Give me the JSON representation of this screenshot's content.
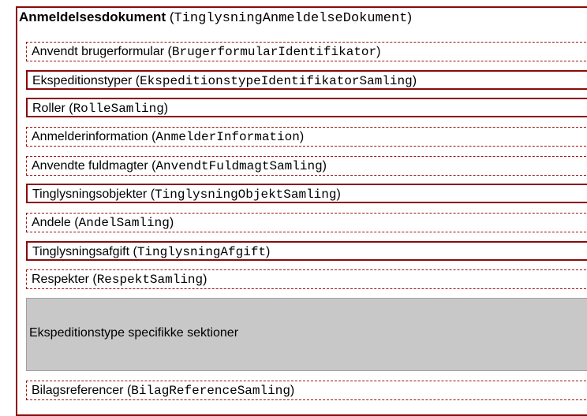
{
  "title": {
    "name": "Anmeldelsesdokument",
    "code": "TinglysningAnmeldelseDokument"
  },
  "rows": [
    {
      "name": "Anvendt brugerformular",
      "code": "BrugerformularIdentifikator",
      "style": "dashed"
    },
    {
      "name": "Ekspeditionstyper",
      "code": "EkspeditionstypeIdentifikatorSamling",
      "style": "solid"
    },
    {
      "name": "Roller",
      "code": "RolleSamling",
      "style": "solid"
    },
    {
      "name": "Anmelderinformation",
      "code": "AnmelderInformation",
      "style": "dashed"
    },
    {
      "name": "Anvendte fuldmagter",
      "code": "AnvendtFuldmagtSamling",
      "style": "dashed"
    },
    {
      "name": "Tinglysningsobjekter",
      "code": "TinglysningObjektSamling",
      "style": "solid"
    },
    {
      "name": "Andele",
      "code": "AndelSamling",
      "style": "dashed"
    },
    {
      "name": "Tinglysningsafgift",
      "code": "TinglysningAfgift",
      "style": "solid"
    },
    {
      "name": "Respekter",
      "code": "RespektSamling",
      "style": "dashed"
    }
  ],
  "section": {
    "label": "Ekspeditionstype specifikke sektioner"
  },
  "footer_row": {
    "name": "Bilagsreferencer",
    "code": "BilagReferenceSamling",
    "style": "dashed"
  },
  "colors": {
    "border": "#8b0a0a",
    "section_fill": "#c8c8c8"
  }
}
